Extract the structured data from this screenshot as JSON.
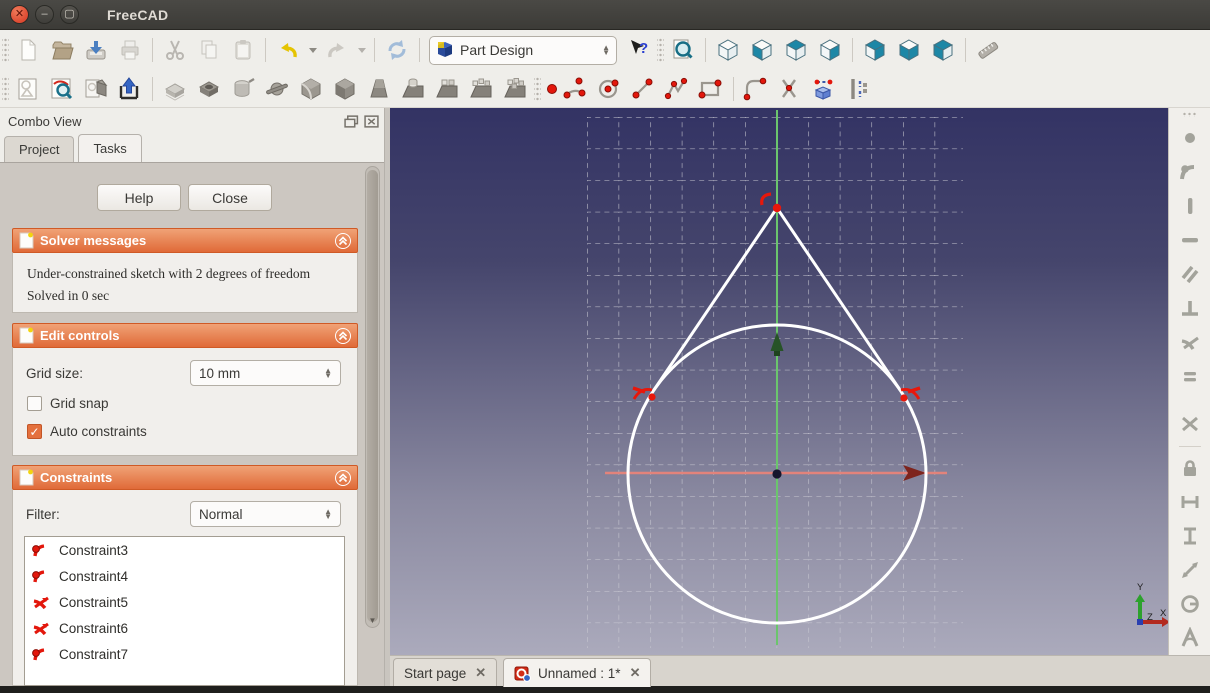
{
  "window": {
    "title": "FreeCAD"
  },
  "titlebar": {
    "controls": [
      "close-button",
      "minimize-button",
      "maximize-button"
    ]
  },
  "toolbars": {
    "workbench_selector": {
      "value": "Part Design"
    },
    "row1_icons": [
      "new-document-icon",
      "open-document-icon",
      "save-icon",
      "print-icon",
      "cut-icon",
      "copy-icon",
      "paste-icon",
      "undo-icon",
      "redo-icon",
      "refresh-icon",
      "whats-this-icon",
      "fit-all-icon",
      "axonometric-view-icon",
      "front-view-icon",
      "top-view-icon",
      "right-view-icon",
      "rear-view-icon",
      "bottom-view-icon",
      "left-view-icon",
      "measure-icon"
    ],
    "row2_icons": [
      "new-sketch-icon",
      "view-sketch-icon",
      "map-sketch-icon",
      "leave-sketch-icon",
      "pad-icon",
      "pocket-icon",
      "revolution-icon",
      "groove-icon",
      "fillet-icon",
      "chamfer-icon",
      "draft-icon",
      "mirrored-icon",
      "linear-pattern-icon",
      "polar-pattern-icon",
      "multitransform-icon",
      "point-tool-icon",
      "arc-tool-icon",
      "circle-tool-icon",
      "line-tool-icon",
      "polyline-tool-icon",
      "rectangle-tool-icon",
      "fillet-sketch-icon",
      "trim-icon",
      "external-geometry-icon",
      "construction-mode-icon"
    ],
    "right_icons": [
      "coincident-constraint-icon",
      "point-on-object-constraint-icon",
      "vertical-constraint-icon",
      "horizontal-constraint-icon",
      "parallel-constraint-icon",
      "perpendicular-constraint-icon",
      "tangent-constraint-icon",
      "equal-constraint-icon",
      "symmetric-constraint-icon",
      "lock-constraint-icon",
      "horizontal-distance-icon",
      "vertical-distance-icon",
      "distance-icon",
      "radius-icon",
      "angle-icon"
    ]
  },
  "combo_view": {
    "title": "Combo View",
    "tabs": {
      "project": "Project",
      "tasks": "Tasks"
    },
    "buttons": {
      "help": "Help",
      "close": "Close"
    },
    "solver": {
      "title": "Solver messages",
      "message": "Under-constrained sketch with 2 degrees of freedom",
      "status": "Solved in 0 sec"
    },
    "edit_controls": {
      "title": "Edit controls",
      "grid_size_label": "Grid size:",
      "grid_size_value": "10 mm",
      "grid_snap_label": "Grid snap",
      "grid_snap_checked": false,
      "auto_constraints_label": "Auto constraints",
      "auto_constraints_checked": true
    },
    "constraints": {
      "title": "Constraints",
      "filter_label": "Filter:",
      "filter_value": "Normal",
      "items": [
        {
          "label": "Constraint3",
          "icon": "point-on-object-icon"
        },
        {
          "label": "Constraint4",
          "icon": "point-on-object-icon"
        },
        {
          "label": "Constraint5",
          "icon": "tangent-icon"
        },
        {
          "label": "Constraint6",
          "icon": "tangent-icon"
        },
        {
          "label": "Constraint7",
          "icon": "point-on-object-icon"
        }
      ]
    }
  },
  "document_tabs": [
    {
      "label": "Start page",
      "active": false
    },
    {
      "label": "Unnamed : 1*",
      "active": true
    }
  ],
  "viewport": {
    "axis_indicator": {
      "x": "X",
      "y": "Y",
      "z": "Z"
    },
    "sketch": {
      "shapes": [
        "circle",
        "tangent-line-left",
        "tangent-line-right"
      ],
      "constraint_markers": [
        "coincident-at-apex",
        "tangent-left",
        "tangent-right"
      ]
    },
    "colors": {
      "bg_top": "#333364",
      "bg_bottom": "#abaabc",
      "grid": "#c9c9d2",
      "geometry": "#ffffff",
      "x_axis": "#e2837b",
      "y_axis": "#6bc56d",
      "constraint_red": "#e8170b"
    }
  },
  "colors": {
    "accent_orange": "#e4703d",
    "titlebar": "#3c3b37",
    "toolbar_bg": "#efeeea",
    "panel_bg": "#ccc7c1"
  }
}
